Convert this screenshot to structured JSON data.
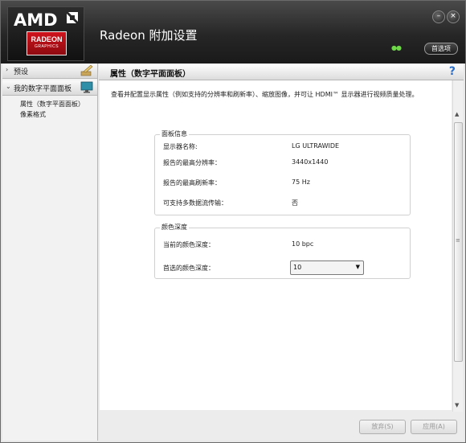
{
  "window": {
    "title": "Radeon 附加设置"
  },
  "logo": {
    "brand": "AMD",
    "product": "RADEON",
    "sub": "GRAPHICS"
  },
  "header": {
    "preferences_label": "首选项",
    "minimize_glyph": "–",
    "close_glyph": "×"
  },
  "sidebar": {
    "groups": [
      {
        "label": "预设",
        "arrow": "›",
        "icon": "pencil-icon"
      },
      {
        "label": "我的数字平面面板",
        "arrow": "⌄",
        "icon": "monitor-icon"
      }
    ],
    "subitems": [
      "属性（数字平面面板）",
      "像素格式"
    ]
  },
  "page": {
    "title": "属性（数字平面面板）",
    "help": "?",
    "description": "查看并配置显示属性（例如支持的分辨率和刷新率）、缩放图像，并可让 HDMI™ 显示器进行视频质量处理。"
  },
  "panel_info": {
    "legend": "面板信息",
    "rows": [
      {
        "label": "显示器名称:",
        "value": "LG ULTRAWIDE"
      },
      {
        "label": "报告的最高分辨率：",
        "value": "3440x1440"
      },
      {
        "label": "报告的最高刷新率：",
        "value": "75 Hz"
      },
      {
        "label": "可支持多数据流传输：",
        "value": "否"
      }
    ]
  },
  "color_depth": {
    "legend": "颜色深度",
    "current_label": "当前的颜色深度：",
    "current_value": "10 bpc",
    "preferred_label": "首选的颜色深度：",
    "preferred_value": "10"
  },
  "footer": {
    "discard_label": "放弃(S)",
    "apply_label": "应用(A)"
  },
  "colors": {
    "accent_red": "#c8101a",
    "header_dark": "#1e1e1e",
    "help_blue": "#2a6fc9"
  }
}
